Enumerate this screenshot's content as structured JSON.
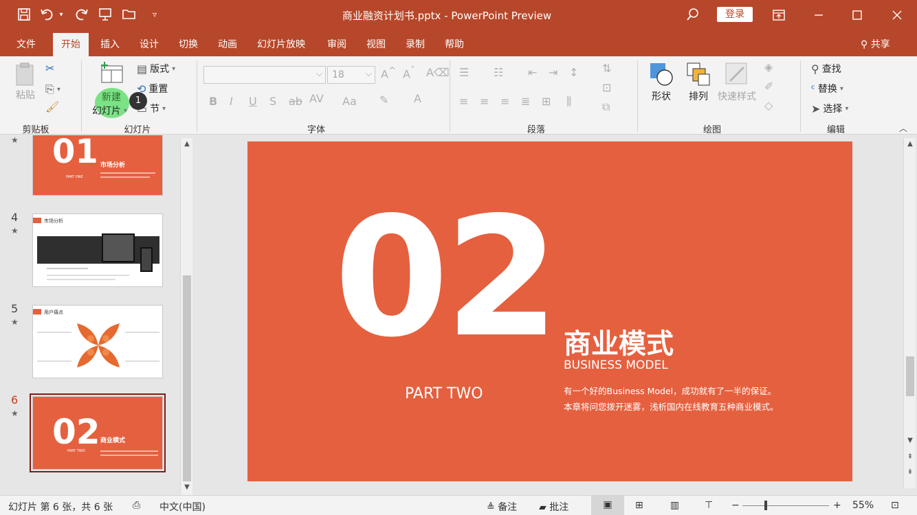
{
  "window": {
    "title": "商业融资计划书.pptx  -  PowerPoint Preview",
    "login": "登录",
    "icons": {
      "save": "save-icon",
      "undo": "undo-icon",
      "redo": "redo-icon",
      "present": "present-icon",
      "open": "folder-icon",
      "more": "customize-icon",
      "search": "search-icon"
    }
  },
  "tabs": [
    "文件",
    "开始",
    "插入",
    "设计",
    "切换",
    "动画",
    "幻灯片放映",
    "审阅",
    "视图",
    "录制",
    "帮助"
  ],
  "share": "共享",
  "ribbon": {
    "clipboard": {
      "paste": "粘贴",
      "label": "剪贴板"
    },
    "slides": {
      "new_slide_1": "新建",
      "new_slide_2": "幻灯片",
      "layout": "版式",
      "reset": "重置",
      "section": "节",
      "label": "幻灯片",
      "badge": "1"
    },
    "font": {
      "size": "18",
      "label": "字体"
    },
    "paragraph": {
      "label": "段落"
    },
    "drawing": {
      "shapes": "形状",
      "arrange": "排列",
      "quick_styles": "快速样式",
      "label": "绘图"
    },
    "editing": {
      "find": "查找",
      "replace": "替换",
      "select": "选择",
      "label": "编辑"
    }
  },
  "thumbnails": [
    {
      "num": "",
      "title": "市场分析",
      "big": "01",
      "part": "PART ONE"
    },
    {
      "num": "4",
      "title": "市场分析"
    },
    {
      "num": "5",
      "title": "用户痛点"
    },
    {
      "num": "6",
      "title": "商业模式",
      "big": "02",
      "part": "PART TWO"
    }
  ],
  "slide": {
    "number": "02",
    "part": "PART TWO",
    "title": "商业模式",
    "subtitle": "BUSINESS MODEL",
    "desc_1": "有一个好的Business Model，成功就有了一半的保证。",
    "desc_2": "本章将问您拨开迷雾，浅析国内在线教育五种商业模式。",
    "bg_color": "#e5603f"
  },
  "status": {
    "slide_info": "幻灯片 第 6 张，共 6 张",
    "language": "中文(中国)",
    "notes": "备注",
    "comments": "批注",
    "zoom": "55%"
  },
  "colors": {
    "accent": "#b7472a",
    "slide": "#e5603f",
    "active_tab_text": "#b7472a"
  }
}
